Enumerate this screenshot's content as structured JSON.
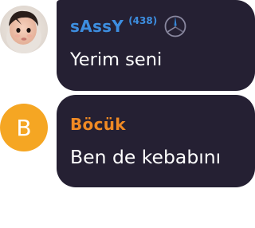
{
  "messages": [
    {
      "username": "sAssY",
      "score": "(438)",
      "text": "Yerim seni",
      "avatar_type": "photo",
      "badge_icon": "mercedes-star-icon",
      "username_color": "#3d8ee0",
      "score_color": "#3d8ee0"
    },
    {
      "username": "Böcük",
      "text": "Ben de kebabını",
      "avatar_letter": "B",
      "avatar_color": "#f5a623",
      "username_color": "#f08a24"
    }
  ],
  "colors": {
    "bubble": "#252033",
    "message_text": "#ffffff"
  }
}
